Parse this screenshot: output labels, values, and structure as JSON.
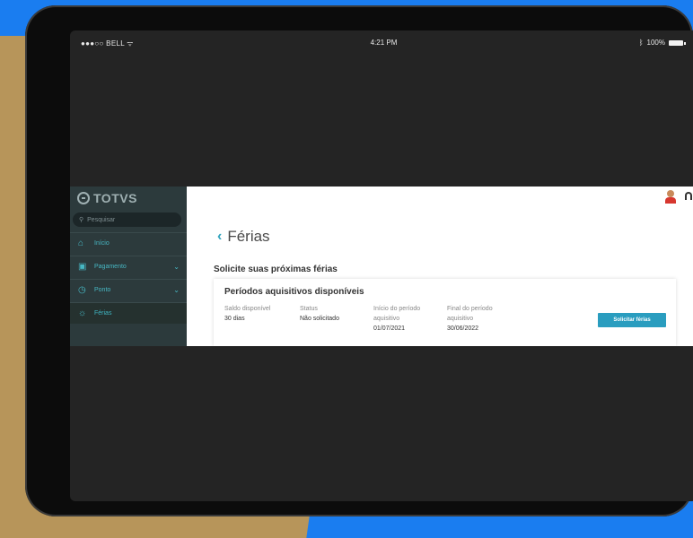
{
  "status_bar": {
    "carrier": "●●●○○ BELL ᯤ",
    "time": "4:21 PM",
    "battery": "100%"
  },
  "sidebar": {
    "logo_text": "TOTVS",
    "search_placeholder": "Pesquisar",
    "items": [
      {
        "label": "Início",
        "icon": "home-icon"
      },
      {
        "label": "Pagamento",
        "icon": "wallet-icon",
        "has_chevron": true
      },
      {
        "label": "Ponto",
        "icon": "clock-icon",
        "has_chevron": true
      },
      {
        "label": "Férias",
        "icon": "sun-icon",
        "active": true
      }
    ]
  },
  "content": {
    "title": "Férias",
    "section_title": "Solicite suas próximas férias",
    "card": {
      "title": "Períodos aquisitivos disponíveis",
      "fields": {
        "saldo": {
          "label": "Saldo disponível",
          "value": "30 dias"
        },
        "status": {
          "label": "Status",
          "value": "Não solicitado"
        },
        "inicio": {
          "label1": "Início do período",
          "label2": "aquisitivo",
          "value": "01/07/2021"
        },
        "final": {
          "label1": "Final do período",
          "label2": "aquisitivo",
          "value": "30/06/2022"
        }
      },
      "button_label": "Solicitar férias"
    }
  },
  "colors": {
    "accent": "#2a9dbf",
    "sidebar_bg": "#2c3a3c",
    "nav_text": "#47b7c3"
  }
}
